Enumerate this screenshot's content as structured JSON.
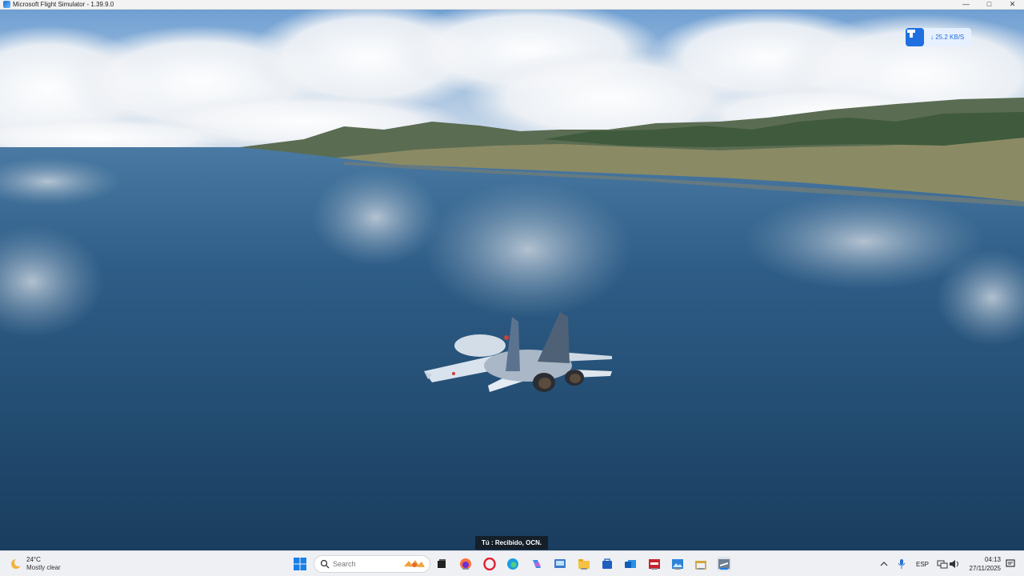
{
  "window": {
    "title": "Microsoft Flight Simulator - 1.39.9.0",
    "minimize_icon": "minimize-icon",
    "maximize_icon": "maximize-icon",
    "close_icon": "close-icon"
  },
  "overlay": {
    "download_speed": "↓ 25.2 KB/S",
    "download_icon": "download-manager-icon"
  },
  "chat": {
    "message": "Tú : Recibido, OCN."
  },
  "taskbar": {
    "weather": {
      "temp": "24°C",
      "condition": "Mostly clear",
      "icon": "weather-moon-icon"
    },
    "search_placeholder": "Search",
    "apps": [
      "start-icon",
      "task-view-icon",
      "firefox-icon",
      "opera-icon",
      "edge-icon",
      "copilot-icon",
      "control-panel-icon",
      "file-explorer-icon",
      "store-icon",
      "outlook-icon",
      "app-red-icon",
      "photos-icon",
      "gift-icon",
      "flight-sim-icon"
    ],
    "tray": {
      "chevron": "chevron-up-icon",
      "mic": "microphone-icon",
      "language": "ESP",
      "network": "network-icon",
      "volume": "volume-icon",
      "time": "04:13",
      "date": "27/11/2025",
      "notification": "notification-icon"
    }
  },
  "colors": {
    "accent": "#1f6fe0",
    "taskbar_bg": "#eef0f4",
    "water": "#2c5a84"
  }
}
